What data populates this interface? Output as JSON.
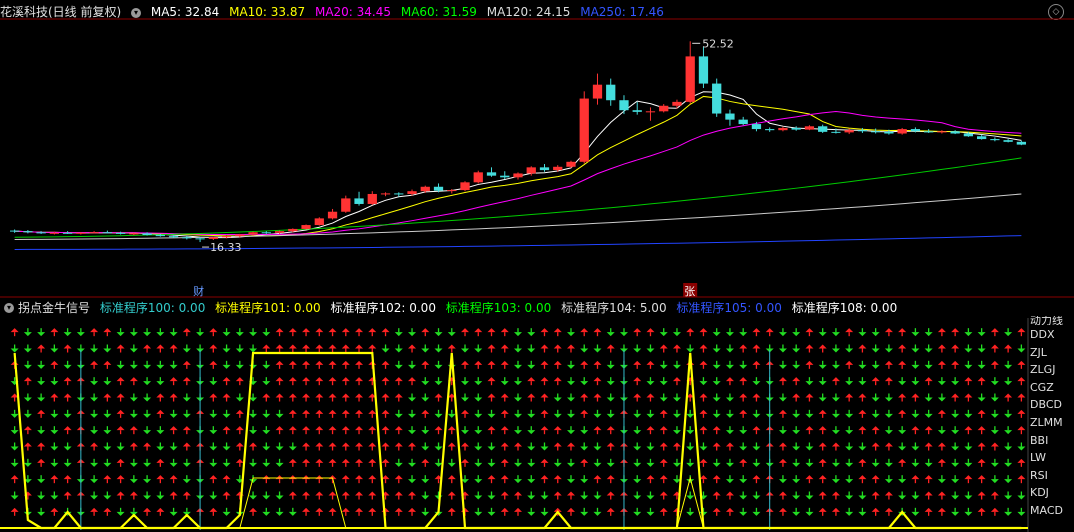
{
  "top_header": {
    "title": "花溪科技(日线 前复权)",
    "ma": [
      {
        "label": "MA5: 32.84",
        "color": "#ffffff"
      },
      {
        "label": "MA10: 33.87",
        "color": "#ffff00"
      },
      {
        "label": "MA20: 34.45",
        "color": "#ff00ff"
      },
      {
        "label": "MA60: 31.59",
        "color": "#00ff00"
      },
      {
        "label": "MA120: 24.15",
        "color": "#dddddd"
      },
      {
        "label": "MA250: 17.46",
        "color": "#3355ff"
      }
    ]
  },
  "bottom_header": {
    "title": "拐点金牛信号",
    "items": [
      {
        "label": "标准程序100: 0.00",
        "color": "#33cccc"
      },
      {
        "label": "标准程序101: 0.00",
        "color": "#ffff00"
      },
      {
        "label": "标准程序102: 0.00",
        "color": "#ffffff"
      },
      {
        "label": "标准程序103: 0.00",
        "color": "#00ff00"
      },
      {
        "label": "标准程序104: 5.00",
        "color": "#dddddd"
      },
      {
        "label": "标准程序105: 0.00",
        "color": "#3355ff"
      },
      {
        "label": "标准程序108: 0.00",
        "color": "#ffffff"
      }
    ]
  },
  "signal_labels": [
    "DDX",
    "ZJL",
    "ZLGJ",
    "CGZ",
    "DBCD",
    "ZLMM",
    "BBI",
    "LW",
    "RSI",
    "KDJ",
    "MACD"
  ],
  "signal_partial_label": "动力线",
  "markers": {
    "cai": "财",
    "zhang": "张",
    "high": "52.52",
    "low": "16.33"
  },
  "chart_data": {
    "type": "candlestick",
    "ylim": [
      14,
      56
    ],
    "candles": [
      [
        18.4,
        18.6,
        18.0,
        18.3
      ],
      [
        18.3,
        18.5,
        17.9,
        18.1
      ],
      [
        18.1,
        18.3,
        17.8,
        17.9
      ],
      [
        17.9,
        18.2,
        17.7,
        18.0
      ],
      [
        18.0,
        18.3,
        17.8,
        17.9
      ],
      [
        17.9,
        18.1,
        17.7,
        18.0
      ],
      [
        18.0,
        18.3,
        17.9,
        18.1
      ],
      [
        18.1,
        18.4,
        17.9,
        18.0
      ],
      [
        18.0,
        18.2,
        17.7,
        17.8
      ],
      [
        17.8,
        18.0,
        17.6,
        17.9
      ],
      [
        17.9,
        18.1,
        17.5,
        17.6
      ],
      [
        17.6,
        17.8,
        17.3,
        17.4
      ],
      [
        17.4,
        17.6,
        17.1,
        17.2
      ],
      [
        17.2,
        17.4,
        16.8,
        17.0
      ],
      [
        17.0,
        17.2,
        16.33,
        16.9
      ],
      [
        16.9,
        17.3,
        16.7,
        17.2
      ],
      [
        17.2,
        17.5,
        17.0,
        17.4
      ],
      [
        17.4,
        17.8,
        17.2,
        17.7
      ],
      [
        17.7,
        18.2,
        17.5,
        18.1
      ],
      [
        18.1,
        18.3,
        17.8,
        18.0
      ],
      [
        18.0,
        18.4,
        17.8,
        18.3
      ],
      [
        18.3,
        18.8,
        18.1,
        18.7
      ],
      [
        18.7,
        19.5,
        18.6,
        19.4
      ],
      [
        19.4,
        20.8,
        19.3,
        20.6
      ],
      [
        20.6,
        22.3,
        20.4,
        21.8
      ],
      [
        21.8,
        24.7,
        21.6,
        24.2
      ],
      [
        24.2,
        25.4,
        22.9,
        23.2
      ],
      [
        23.2,
        25.5,
        23.0,
        25.0
      ],
      [
        25.0,
        25.3,
        24.6,
        25.1
      ],
      [
        25.1,
        25.3,
        24.5,
        25.0
      ],
      [
        25.0,
        25.8,
        24.7,
        25.5
      ],
      [
        25.5,
        26.5,
        25.2,
        26.3
      ],
      [
        26.3,
        26.9,
        25.3,
        25.6
      ],
      [
        25.6,
        25.9,
        25.1,
        25.7
      ],
      [
        25.7,
        27.3,
        25.5,
        27.1
      ],
      [
        27.1,
        29.2,
        26.9,
        28.9
      ],
      [
        28.9,
        29.8,
        28.1,
        28.3
      ],
      [
        28.3,
        29.1,
        27.7,
        28.0
      ],
      [
        28.0,
        28.9,
        27.6,
        28.7
      ],
      [
        28.7,
        30.0,
        28.3,
        29.8
      ],
      [
        29.8,
        30.4,
        29.0,
        29.3
      ],
      [
        29.3,
        30.2,
        29.0,
        29.9
      ],
      [
        29.9,
        31.0,
        29.7,
        30.8
      ],
      [
        30.8,
        43.5,
        30.5,
        42.2
      ],
      [
        42.2,
        46.7,
        41.1,
        44.7
      ],
      [
        44.7,
        45.8,
        40.9,
        41.9
      ],
      [
        41.9,
        42.8,
        39.4,
        40.1
      ],
      [
        40.1,
        41.6,
        39.3,
        39.8
      ],
      [
        39.8,
        40.6,
        38.2,
        39.9
      ],
      [
        39.9,
        41.2,
        39.7,
        40.9
      ],
      [
        40.9,
        42.0,
        40.4,
        41.6
      ],
      [
        41.6,
        52.52,
        41.3,
        49.8
      ],
      [
        49.8,
        51.6,
        44.1,
        44.9
      ],
      [
        44.9,
        45.8,
        38.9,
        39.5
      ],
      [
        39.5,
        40.2,
        37.3,
        38.4
      ],
      [
        38.4,
        38.9,
        37.4,
        37.6
      ],
      [
        37.6,
        38.0,
        36.3,
        36.7
      ],
      [
        36.7,
        37.0,
        36.2,
        36.5
      ],
      [
        36.5,
        37.1,
        36.3,
        36.9
      ],
      [
        36.9,
        37.2,
        36.4,
        36.6
      ],
      [
        36.6,
        37.4,
        36.5,
        37.2
      ],
      [
        37.2,
        37.5,
        36.0,
        36.2
      ],
      [
        36.2,
        36.8,
        35.9,
        36.1
      ],
      [
        36.1,
        36.8,
        35.8,
        36.5
      ],
      [
        36.5,
        36.9,
        36.0,
        36.3
      ],
      [
        36.3,
        36.8,
        35.9,
        36.2
      ],
      [
        36.2,
        36.6,
        35.7,
        35.9
      ],
      [
        35.9,
        36.9,
        35.7,
        36.7
      ],
      [
        36.7,
        37.0,
        36.1,
        36.3
      ],
      [
        36.3,
        36.7,
        36.0,
        36.1
      ],
      [
        36.1,
        36.5,
        35.9,
        36.3
      ],
      [
        36.3,
        36.5,
        35.8,
        35.9
      ],
      [
        35.9,
        36.2,
        35.3,
        35.4
      ],
      [
        35.4,
        35.7,
        34.8,
        34.9
      ],
      [
        34.9,
        35.2,
        34.5,
        34.7
      ],
      [
        34.7,
        34.9,
        34.3,
        34.4
      ],
      [
        34.4,
        34.6,
        33.8,
        33.9
      ]
    ],
    "signal_rows": [
      "uddudduudddddududddduuuuuuuuuddudduuuudduuduudduudduuddduudduddudduudduuddudu",
      "ddududdduduuudduddduuuuuuuuudduddudduudduuudduddduududduuddduudduddudduudduud",
      "uddudduudddddududddduuuuuuuuuddudduuuudduuduudduudduuddduudduddudduudduuddudu",
      "dudduudduudduudduudduuuuuuuuuuudduddudduuudduddudduudduudduuddudduuddudduuddu",
      "udduudduudduudduudduuuuuuuuuuudduudduuduudduudduudduudduudduudduudduudduudduu",
      "ddudduddudduddudduddduuuuuuuuddudduddudduddudduddudduddudduddudduddudduddudduu",
      "dudduudduudduudduudduuuuuuuuuudduudduudduudduudduudduudduudduudduudduudduudduu",
      "duudduudduudduudduuddduuuuuuuuudduudduudduudduudduudduudduudduudduudduudduuddu",
      "ddudduddudduddudduddduuuuuuuuddudduddudduddudduddudduddudduddudduddudduddudduu",
      "udduudduudduudduudduuuuuuuuuuudduudduudduudduudduudduudduudduudduudduudduudduu",
      "dudduudduudduudduuddduuuuuuuuuudduudduudduudduudduudduudduudduudduudduudduuddu",
      "uddudduudduudduudduddduuuuuuuuudduudduudduudduudduudduudduudduudduudduudduuddu"
    ]
  }
}
